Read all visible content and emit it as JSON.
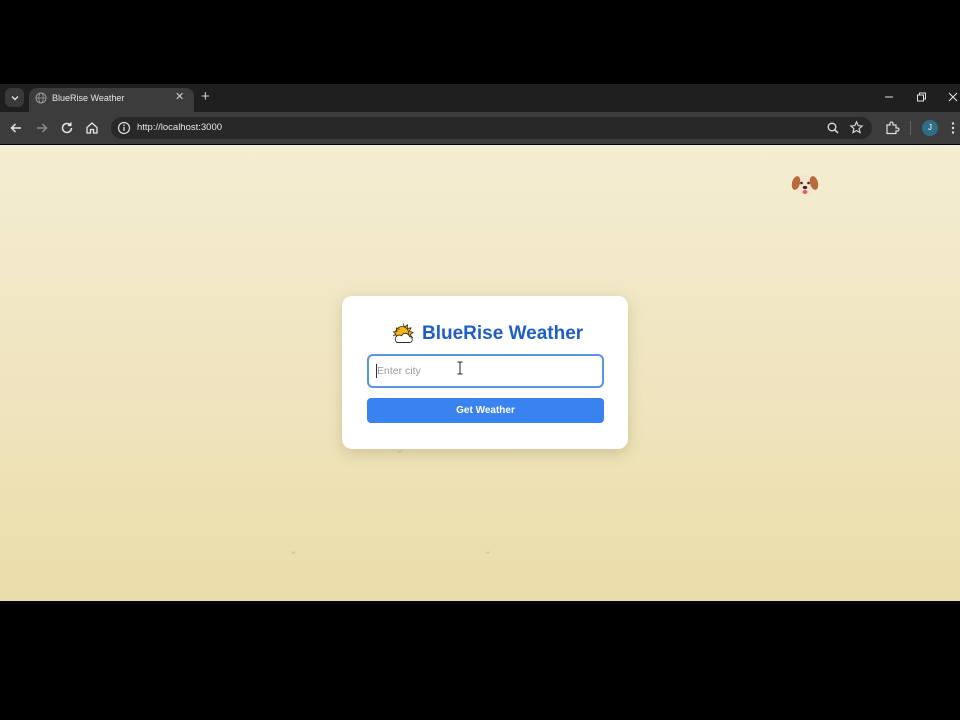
{
  "browser": {
    "tab_title": "BlueRise Weather",
    "url": "http://localhost:3000",
    "profile_initial": "J",
    "icons": {
      "tab_list": "chevron-down-icon",
      "favicon": "globe-icon",
      "tab_close": "close-icon",
      "new_tab": "plus-icon",
      "minimize": "minimize-icon",
      "maximize": "restore-icon",
      "close_window": "close-icon",
      "back": "arrow-left-icon",
      "forward": "arrow-right-icon",
      "reload": "reload-icon",
      "home": "home-icon",
      "site_info": "info-icon",
      "zoom": "zoom-icon",
      "bookmark": "star-icon",
      "extensions": "puzzle-icon",
      "menu": "kebab-menu-icon"
    }
  },
  "page": {
    "app_title": "BlueRise Weather",
    "app_icon": "sun-cloud-icon",
    "decor_icon": "dog-face-icon",
    "city_input": {
      "placeholder": "Enter city",
      "value": ""
    },
    "submit_label": "Get Weather"
  },
  "colors": {
    "accent": "#3a82f0",
    "title": "#1f5ec7",
    "input_border": "#5b93e6",
    "background_top": "#f4edd2",
    "background_bottom": "#ebdda9"
  }
}
